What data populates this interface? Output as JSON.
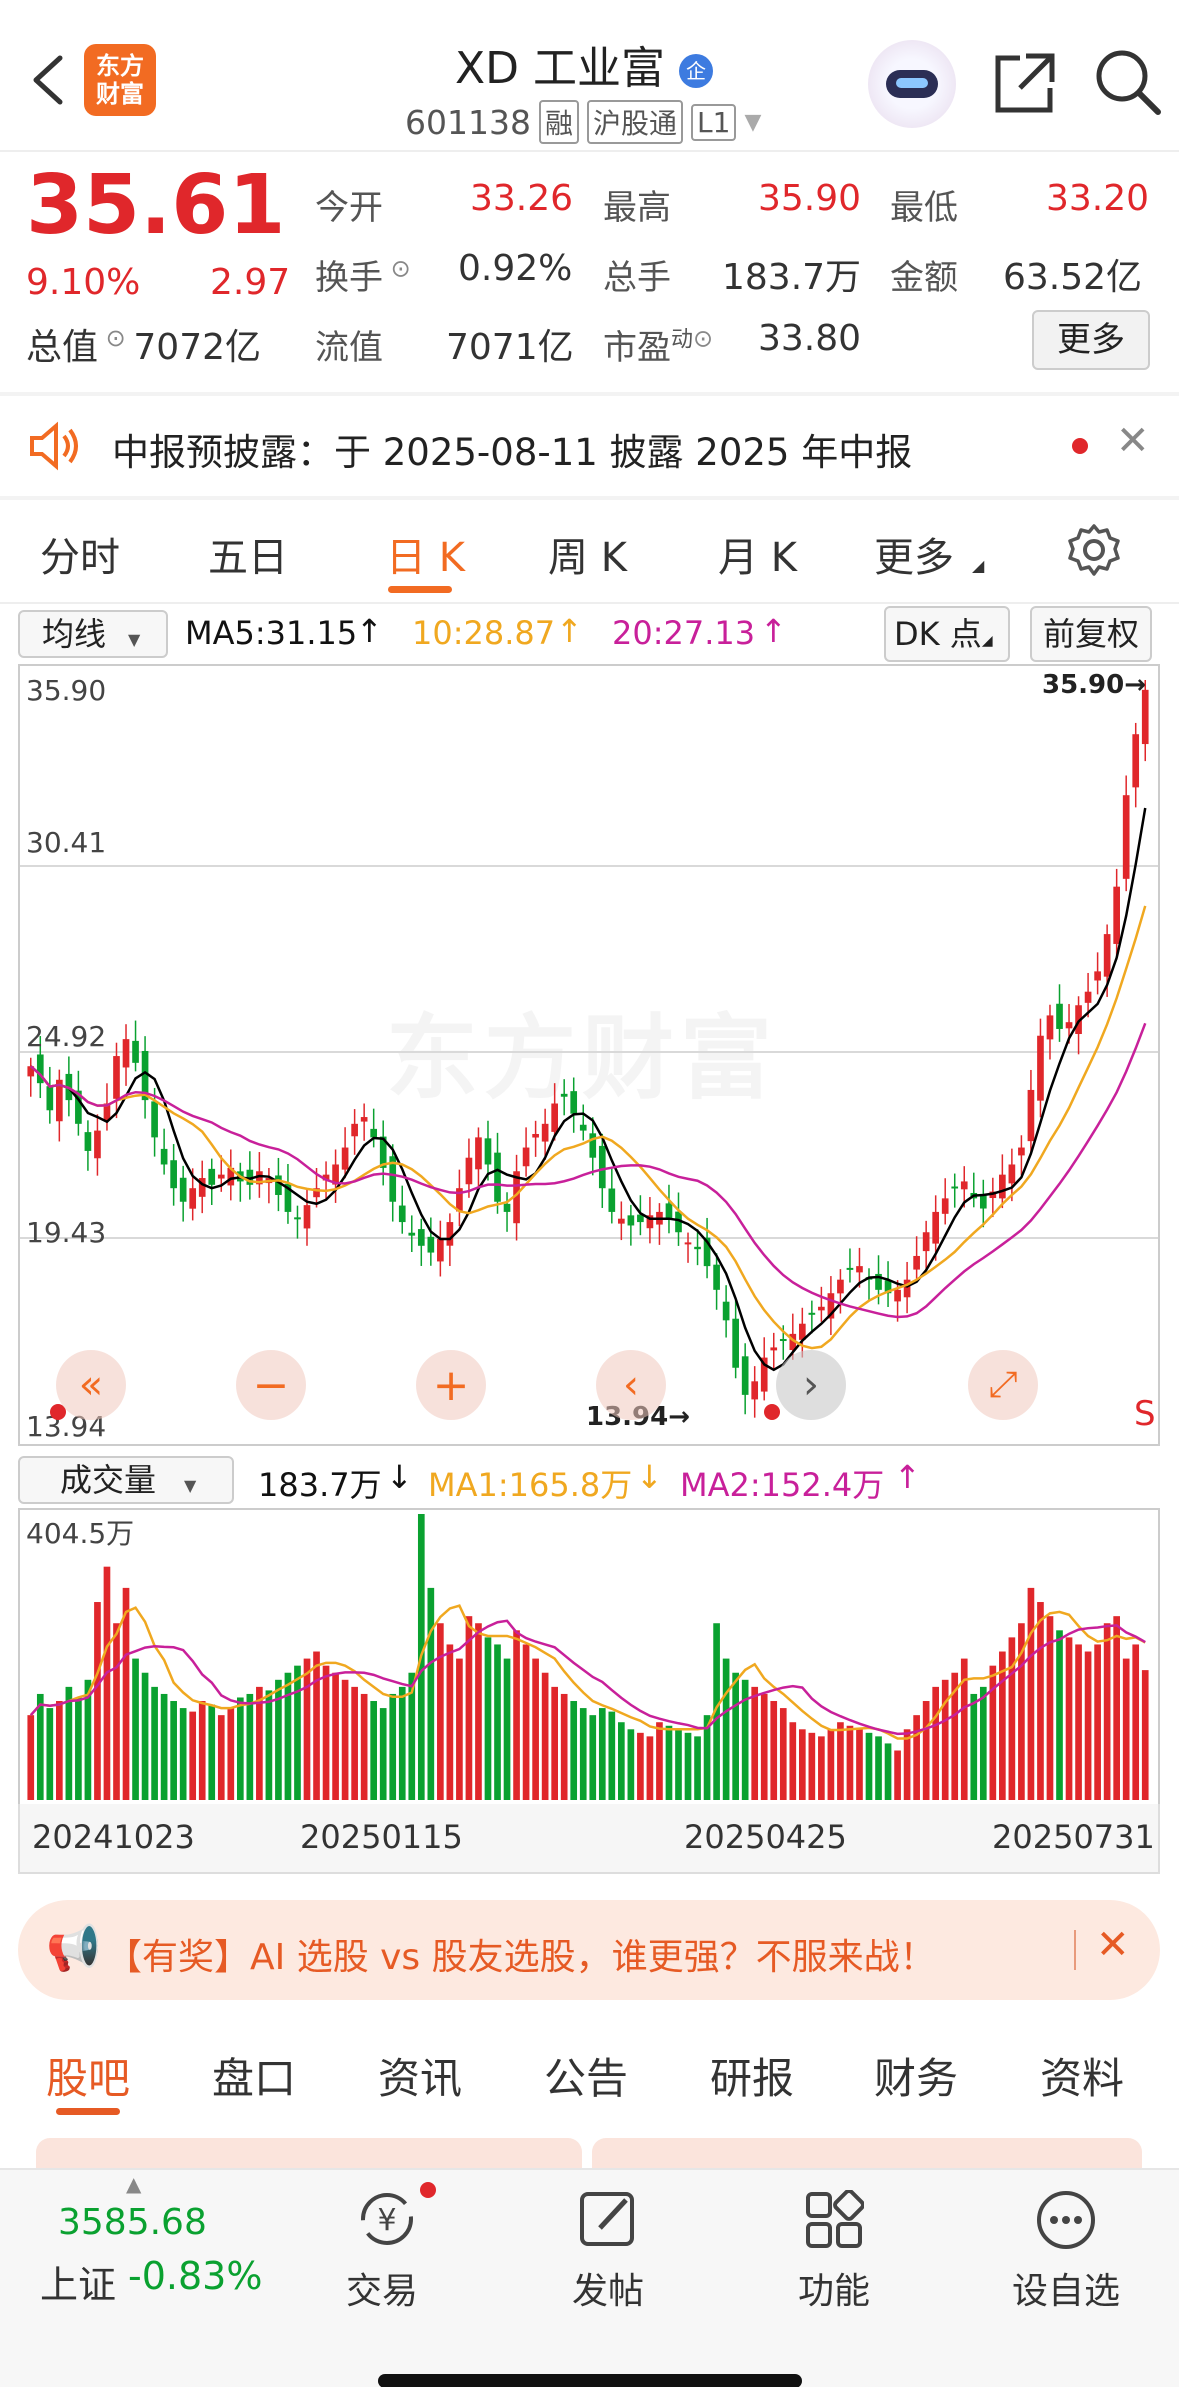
{
  "header": {
    "logo_text": [
      "东方",
      "财富"
    ],
    "title": "XD 工业富",
    "title_badge": "企",
    "code": "601138",
    "tags": [
      "融",
      "沪股通",
      "L1"
    ]
  },
  "quote": {
    "price": "35.61",
    "pct": "9.10%",
    "change": "2.97",
    "open_label": "今开",
    "open": "33.26",
    "high_label": "最高",
    "high": "35.90",
    "low_label": "最低",
    "low": "33.20",
    "turnover_label": "换手",
    "turnover": "0.92%",
    "volume_label": "总手",
    "volume": "183.7万",
    "amount_label": "金额",
    "amount": "63.52亿",
    "mcap_label": "总值",
    "mcap": "7072亿",
    "float_label": "流值",
    "float": "7071亿",
    "pe_label": "市盈",
    "pe_sup": "动",
    "pe": "33.80",
    "more_button": "更多"
  },
  "notice": {
    "text": "中报预披露：于 2025-08-11 披露 2025 年中报"
  },
  "chart_tabs": [
    "分时",
    "五日",
    "日 K",
    "周 K",
    "月 K",
    "更多"
  ],
  "chart_tabs_active": "日 K",
  "ma_bar": {
    "selector": "均线",
    "ma5": "MA5:31.15",
    "ma10": "10:28.87",
    "ma20": "20:27.13",
    "dk_button": "DK 点",
    "fq_button": "前复权"
  },
  "price_axis": [
    "35.90",
    "30.41",
    "24.92",
    "19.43",
    "13.94"
  ],
  "price_marks": {
    "high": "35.90→",
    "low": "13.94→",
    "s_mark": "S"
  },
  "watermark": "东方财富",
  "vol_bar": {
    "selector": "成交量",
    "vol": "183.7万",
    "ma1": "MA1:165.8万",
    "ma2": "MA2:152.4万",
    "max_label": "404.5万"
  },
  "date_axis": [
    "20241023",
    "20250115",
    "20250425",
    "20250731"
  ],
  "promo": {
    "text": "【有奖】AI 选股 vs 股友选股，谁更强？不服来战！"
  },
  "bottom_tabs": [
    "股吧",
    "盘口",
    "资讯",
    "公告",
    "研报",
    "财务",
    "资料"
  ],
  "bottom_tabs_active": "股吧",
  "footer": {
    "index_value": "3585.68",
    "index_name": "上证",
    "index_pct": "-0.83%",
    "items": [
      "交易",
      "发帖",
      "功能",
      "设自选"
    ]
  },
  "colors": {
    "up": "#e0272b",
    "down": "#0aa130",
    "accent": "#f26b22",
    "ma5": "#000000",
    "ma10": "#f0a820",
    "ma20": "#c8209a"
  },
  "chart_data": {
    "type": "candlestick",
    "title": "",
    "ylim": [
      13.94,
      35.9
    ],
    "x_ticks": [
      "20241023",
      "20250115",
      "20250425",
      "20250731"
    ],
    "close": [
      24.5,
      24.0,
      23.2,
      24.1,
      23.5,
      22.8,
      22.0,
      22.6,
      23.4,
      24.8,
      25.3,
      24.6,
      23.5,
      22.4,
      21.6,
      20.9,
      20.5,
      20.9,
      21.2,
      21.0,
      21.3,
      21.5,
      21.1,
      21.0,
      21.4,
      21.2,
      20.7,
      20.2,
      20.0,
      20.4,
      20.9,
      21.3,
      21.6,
      22.1,
      22.8,
      23.0,
      22.4,
      21.5,
      20.5,
      19.9,
      19.5,
      19.2,
      19.0,
      19.4,
      19.9,
      20.9,
      21.8,
      22.4,
      21.6,
      20.5,
      20.2,
      21.4,
      22.1,
      22.5,
      22.8,
      23.4,
      23.6,
      23.1,
      22.6,
      21.8,
      20.9,
      20.2,
      20.0,
      19.8,
      19.9,
      20.1,
      20.2,
      20.0,
      19.6,
      19.3,
      19.1,
      18.6,
      17.9,
      17.0,
      15.6,
      14.8,
      15.2,
      15.9,
      16.2,
      16.4,
      16.6,
      16.9,
      17.2,
      17.4,
      17.8,
      18.2,
      18.5,
      18.6,
      18.2,
      17.9,
      17.8,
      17.9,
      18.2,
      18.9,
      19.6,
      20.2,
      20.6,
      20.9,
      21.1,
      20.6,
      20.3,
      20.8,
      21.3,
      21.6,
      22.1,
      23.8,
      25.4,
      26.0,
      25.6,
      25.8,
      26.3,
      26.7,
      27.3,
      28.4,
      29.8,
      32.5,
      34.3,
      35.61
    ],
    "ma": [
      {
        "name": "MA5",
        "value": 31.15
      },
      {
        "name": "MA10",
        "value": 28.87
      },
      {
        "name": "MA20",
        "value": 27.13
      }
    ],
    "volume": [
      120,
      150,
      130,
      140,
      160,
      145,
      170,
      280,
      330,
      250,
      300,
      200,
      180,
      160,
      150,
      140,
      130,
      125,
      140,
      135,
      120,
      130,
      145,
      150,
      160,
      155,
      170,
      180,
      190,
      200,
      210,
      190,
      180,
      170,
      160,
      150,
      140,
      130,
      150,
      160,
      180,
      404.5,
      300,
      250,
      220,
      200,
      260,
      250,
      230,
      220,
      200,
      240,
      220,
      200,
      180,
      160,
      150,
      140,
      130,
      120,
      130,
      125,
      110,
      100,
      95,
      90,
      110,
      105,
      100,
      95,
      90,
      120,
      250,
      200,
      180,
      170,
      160,
      150,
      140,
      130,
      110,
      100,
      95,
      90,
      100,
      110,
      105,
      100,
      95,
      90,
      80,
      70,
      100,
      120,
      140,
      160,
      170,
      180,
      200,
      150,
      160,
      190,
      210,
      230,
      250,
      300,
      280,
      260,
      240,
      230,
      220,
      210,
      220,
      250,
      260,
      200,
      220,
      183.7
    ],
    "volume_max": 404.5,
    "volume_unit": "万"
  }
}
